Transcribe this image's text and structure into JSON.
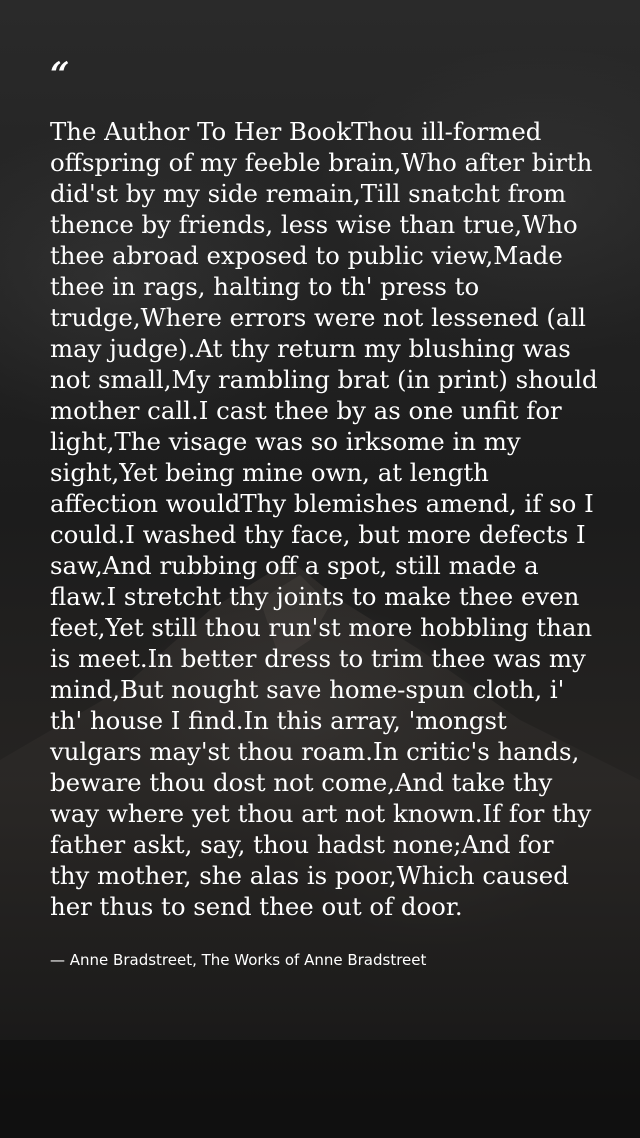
{
  "quote": {
    "mark": "“",
    "text": "The Author To Her BookThou ill-formed offspring of my feeble brain,Who after birth did'st by my side remain,Till snatcht from thence by friends, less wise than true,Who thee abroad exposed to public view,Made thee in rags, halting to th' press to trudge,Where errors were not lessened (all may judge).At thy return my blushing was not small,My rambling brat (in print) should mother call.I cast thee by as one unfit for light,The visage was so irksome in my sight,Yet being mine own, at length affection wouldThy blemishes amend, if so I could.I washed thy face, but more defects I saw,And rubbing off a spot, still made a flaw.I stretcht thy joints to make thee even feet,Yet still thou run'st more hobbling than is meet.In better dress to trim thee was my mind,But nought save home-spun cloth, i' th' house I find.In this array, 'mongst vulgars may'st thou roam.In critic's hands, beware thou dost not come,And take thy way where yet thou art not known.If for thy father askt, say, thou hadst none;And for thy mother, she alas is poor,Which caused her thus to send thee out of door.",
    "attribution": "— Anne Bradstreet, The Works of Anne Bradstreet"
  },
  "colors": {
    "text": "#ffffff",
    "background": "#222222"
  }
}
